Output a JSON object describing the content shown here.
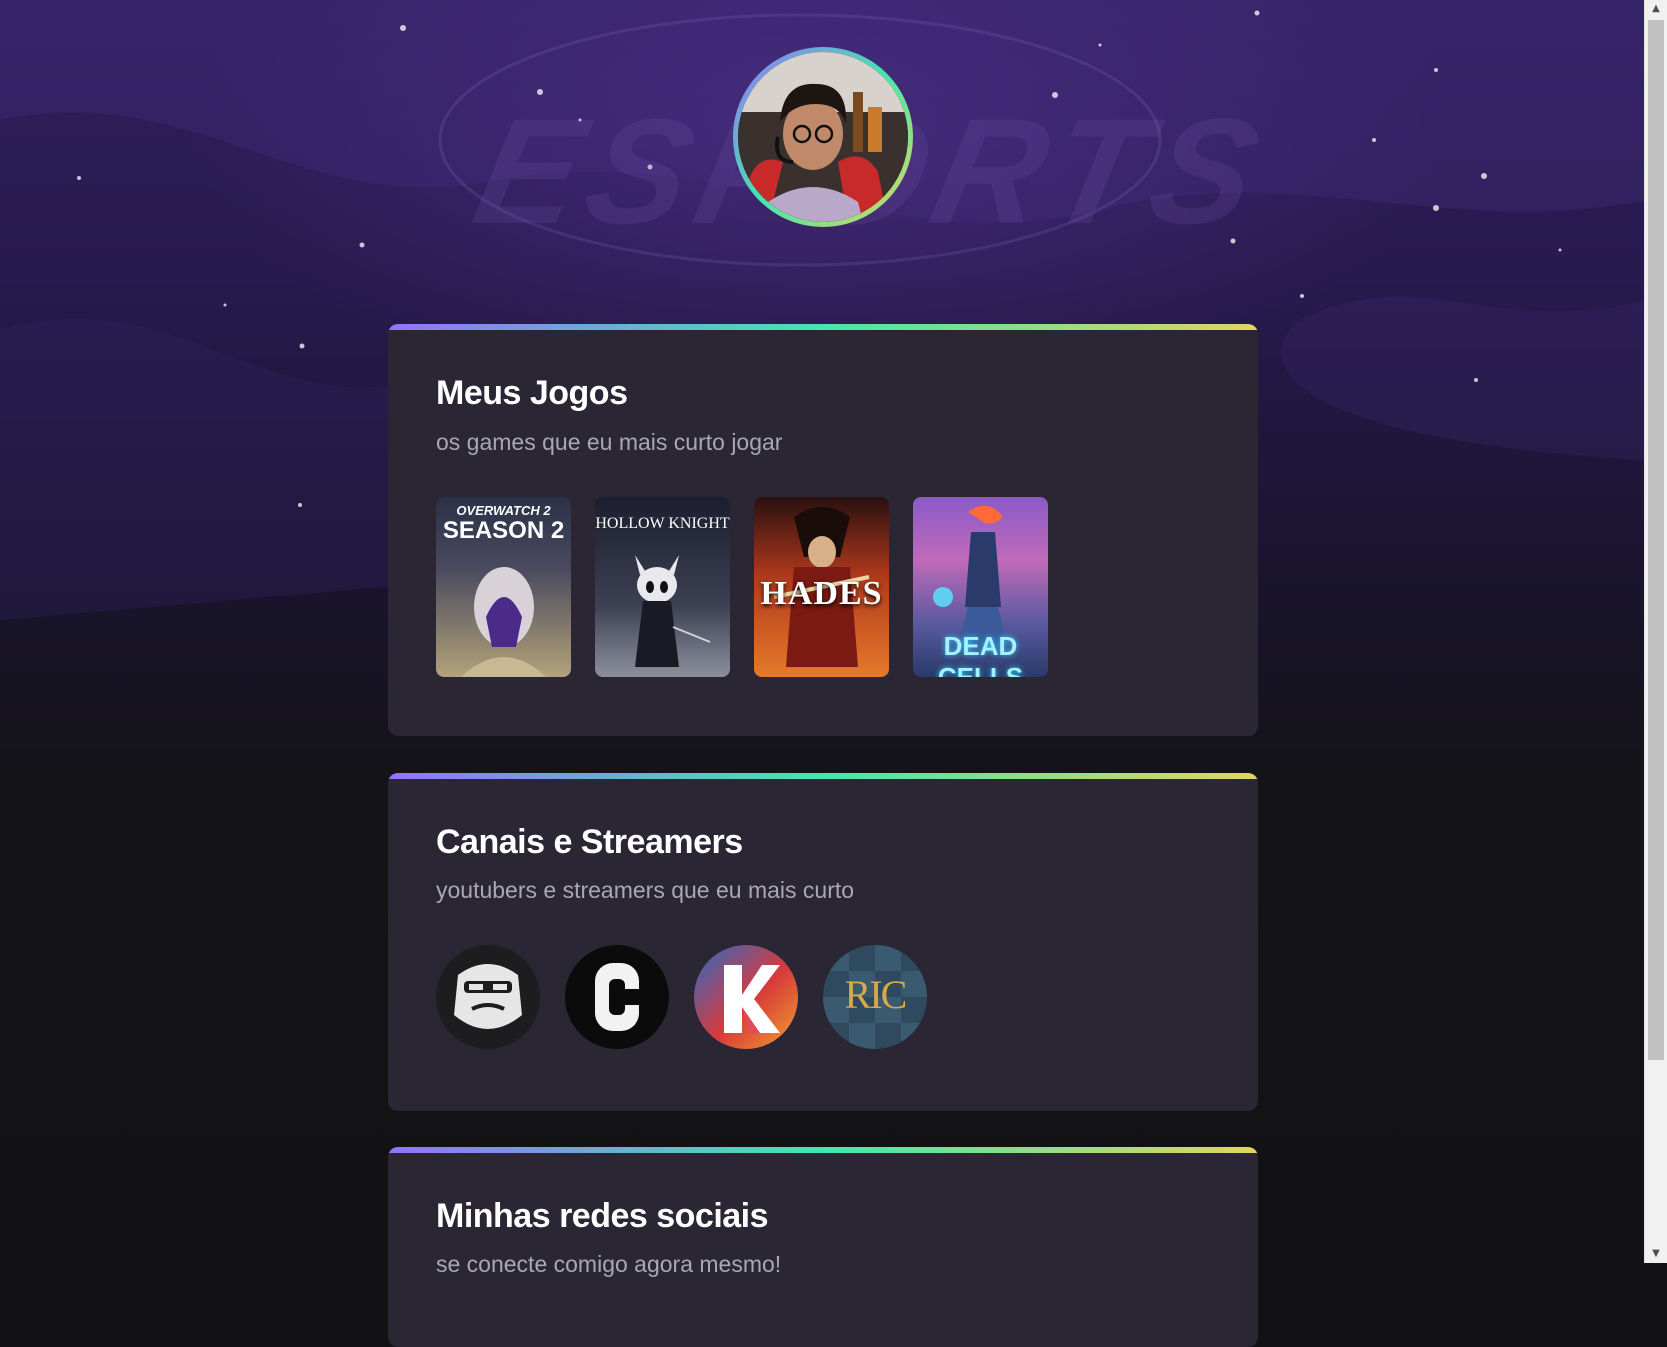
{
  "profile": {
    "avatar_alt": "Foto de perfil"
  },
  "background": {
    "watermark": "ESPORTS"
  },
  "sections": {
    "games": {
      "title": "Meus Jogos",
      "subtitle": "os games que eu mais curto jogar",
      "items": [
        {
          "name": "Overwatch 2 Season 2",
          "line1": "OVERWATCH 2",
          "line2": "SEASON 2"
        },
        {
          "name": "Hollow Knight",
          "line1": "HOLLOW KNIGHT"
        },
        {
          "name": "Hades",
          "line1": "HADES"
        },
        {
          "name": "Dead Cells",
          "line1": "DEAD CELLS"
        }
      ]
    },
    "channels": {
      "title": "Canais e Streamers",
      "subtitle": "youtubers e streamers que eu mais curto",
      "items": [
        {
          "name": "gorilla-channel"
        },
        {
          "name": "c-logo-channel"
        },
        {
          "name": "k-logo-channel"
        },
        {
          "name": "ric-channel",
          "monogram": "RIC"
        }
      ]
    },
    "social": {
      "title": "Minhas redes sociais",
      "subtitle": "se conecte comigo agora mesmo!"
    }
  },
  "colors": {
    "gradient_start": "#9572fc",
    "gradient_mid": "#43e7ad",
    "gradient_end": "#e1d55d",
    "card_bg": "#2a2634",
    "page_bg": "#121214"
  }
}
